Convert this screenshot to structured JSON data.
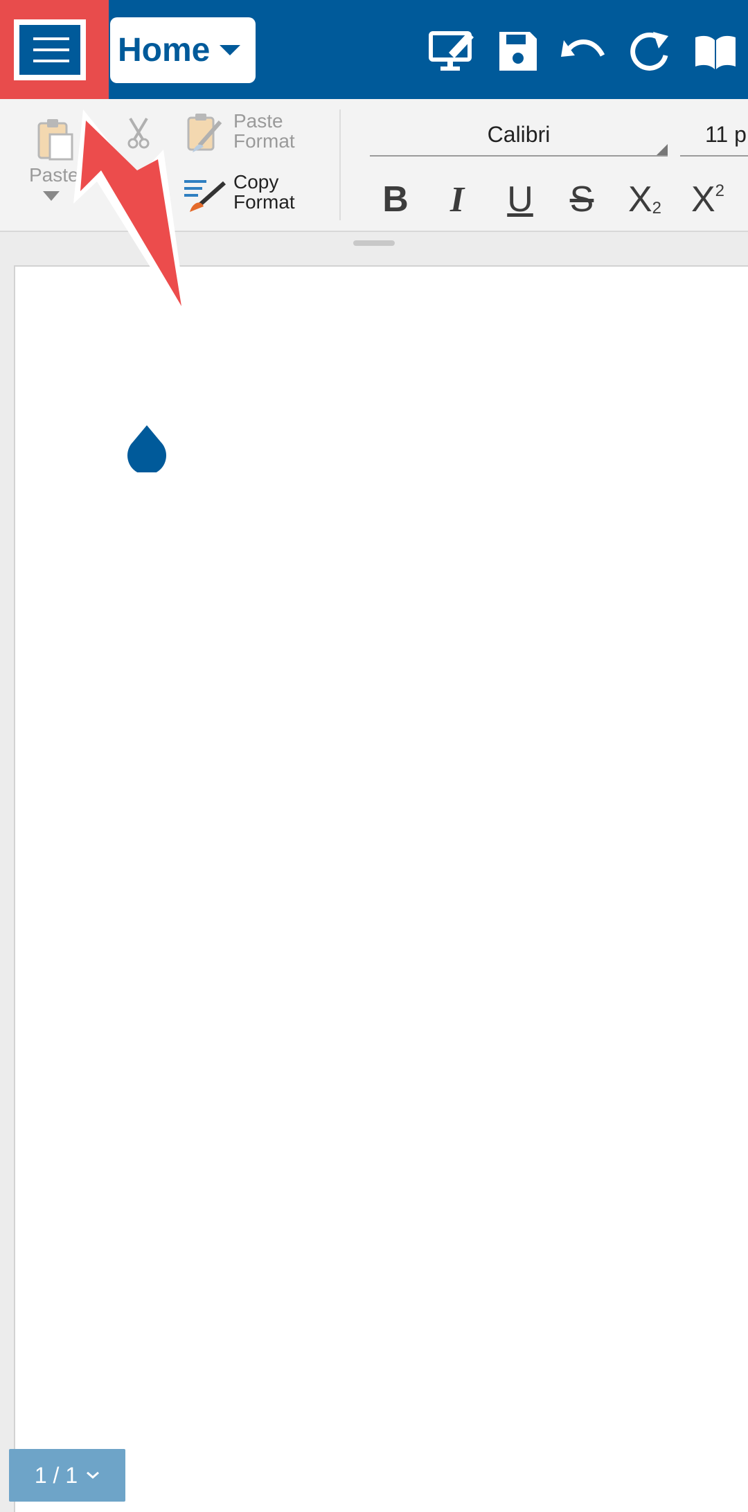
{
  "topbar": {
    "tab_label": "Home",
    "icons": [
      "hamburger-icon",
      "tab-dropdown-icon",
      "screen-edit-icon",
      "save-icon",
      "undo-icon",
      "redo-icon",
      "read-mode-icon"
    ]
  },
  "ribbon": {
    "paste_label": "Paste",
    "paste_format_line1": "Paste",
    "paste_format_line2": "Format",
    "copy_format_line1": "Copy",
    "copy_format_line2": "Format",
    "font_name": "Calibri",
    "font_size": "11 p",
    "bold_label": "B",
    "italic_label": "I",
    "underline_label": "U",
    "strike_label": "S",
    "subscript_label": "X",
    "subscript_small": "2",
    "superscript_label": "X",
    "superscript_small": "2"
  },
  "page_indicator": {
    "label": "1 / 1"
  },
  "colors": {
    "brand": "#005a9a",
    "highlight": "#e84c4c",
    "page_indicator_bg": "#6ea4c8"
  }
}
